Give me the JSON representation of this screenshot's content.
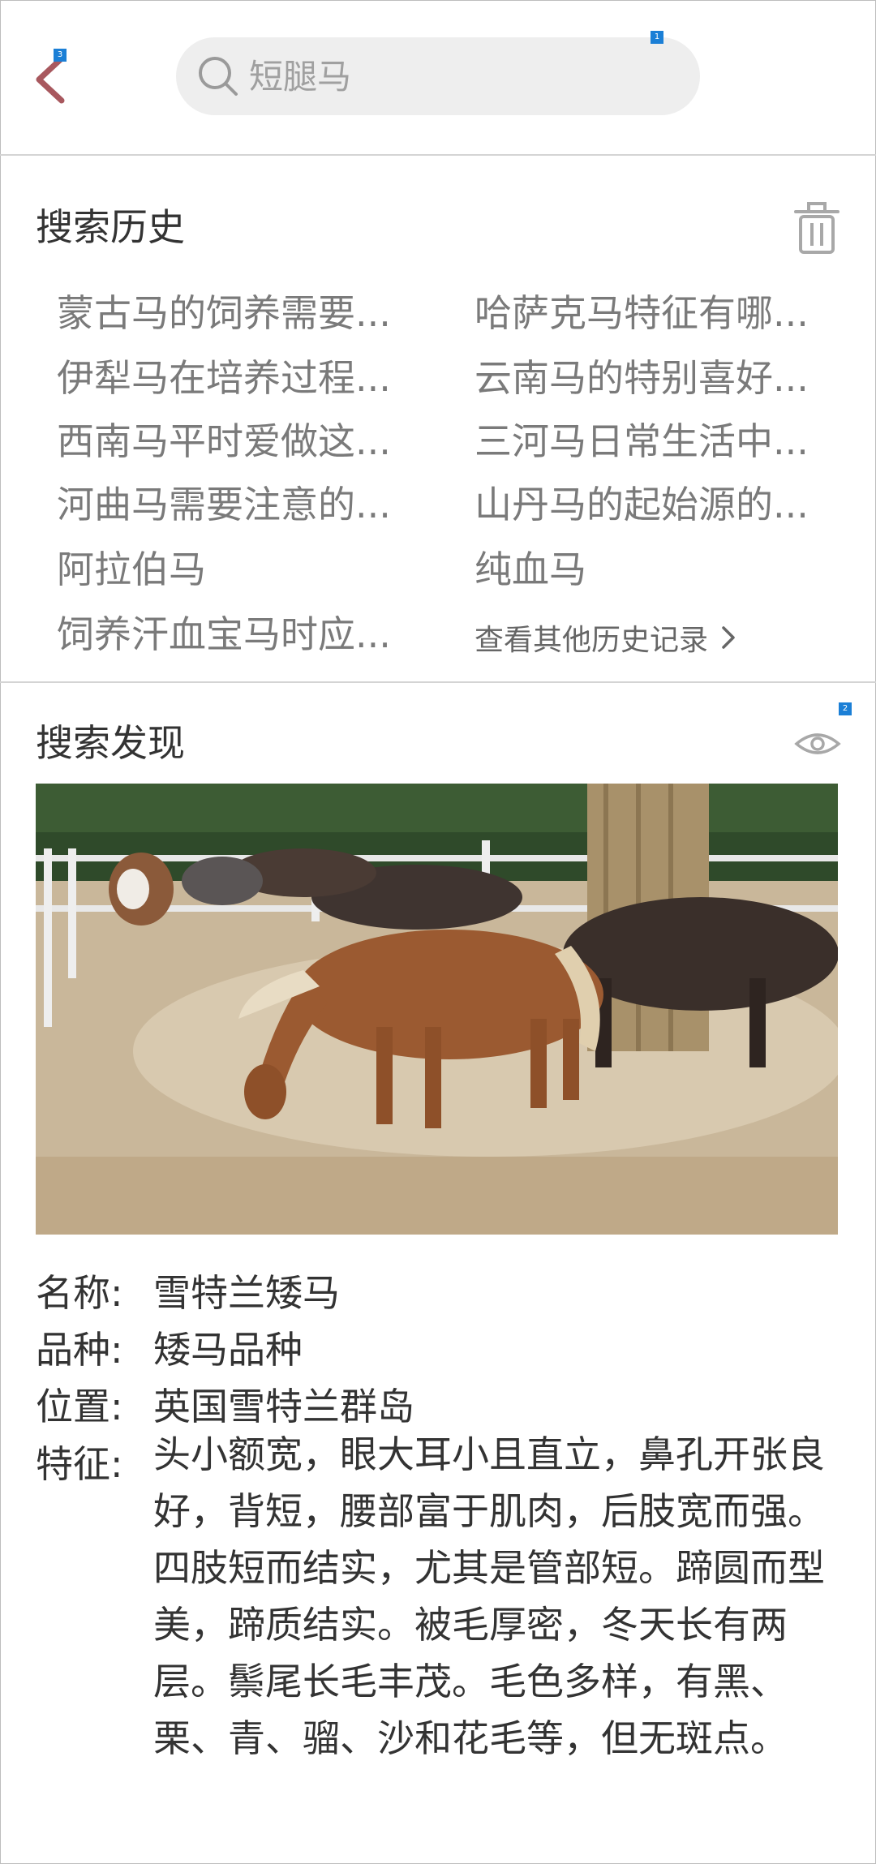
{
  "search": {
    "placeholder": "短腿马"
  },
  "badges": {
    "back": "3",
    "search": "1",
    "discover": "2"
  },
  "history": {
    "title": "搜索历史",
    "items": [
      "蒙古马的饲养需要...",
      "哈萨克马特征有哪...",
      "伊犁马在培养过程...",
      "云南马的特别喜好...",
      "西南马平时爱做这...",
      "三河马日常生活中...",
      "河曲马需要注意的...",
      "山丹马的起始源的...",
      "阿拉伯马",
      "纯血马",
      "饲养汗血宝马时应..."
    ],
    "more_label": "查看其他历史记录"
  },
  "discover": {
    "title": "搜索发现",
    "fields": {
      "name_label": "名称:",
      "name_value": "雪特兰矮马",
      "breed_label": "品种:",
      "breed_value": "矮马品种",
      "location_label": "位置:",
      "location_value": "英国雪特兰群岛",
      "feature_label": "特征:",
      "feature_value": "头小额宽，眼大耳小且直立，鼻孔开张良好，背短，腰部富于肌肉，后肢宽而强。四肢短而结实，尤其是管部短。蹄圆而型美，蹄质结实。被毛厚密，冬天长有两层。鬃尾长毛丰茂。毛色多样，有黑、栗、青、骝、沙和花毛等，但无斑点。"
    }
  },
  "colors": {
    "accent": "#a8585e",
    "badge": "#1b7fd6",
    "search_bg": "#eeeeee"
  }
}
